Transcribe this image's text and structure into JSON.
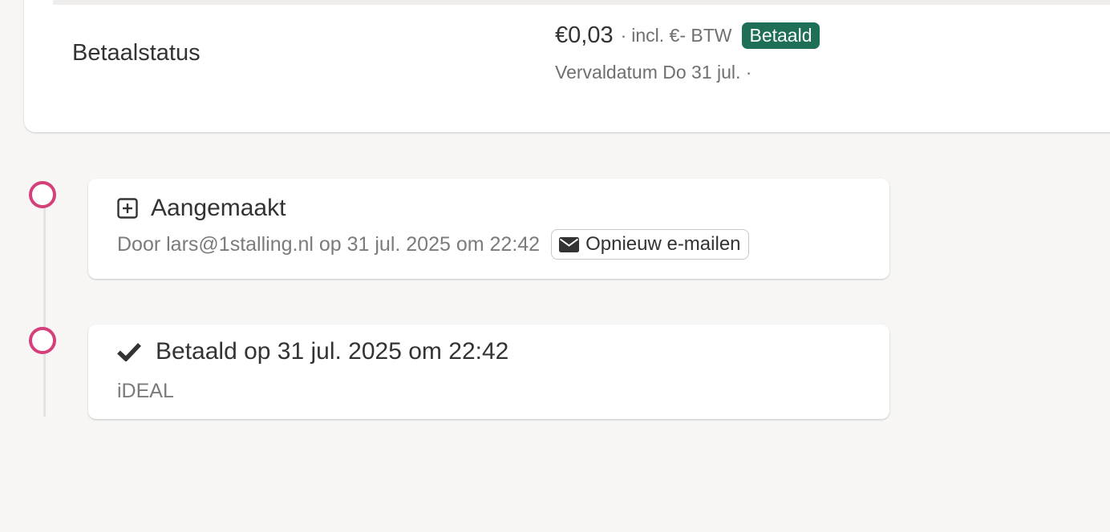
{
  "payment": {
    "label": "Betaalstatus",
    "amount": "€0,03",
    "separator": "·",
    "vat": "incl. €- BTW",
    "status_badge": "Betaald",
    "due": "Vervaldatum Do 31 jul. ·"
  },
  "timeline": {
    "events": [
      {
        "icon": "plus-square-icon",
        "title": "Aangemaakt",
        "meta": "Door lars@1stalling.nl op 31 jul. 2025 om 22:42",
        "action": {
          "icon": "envelope-icon",
          "label": "Opnieuw e-mailen"
        }
      },
      {
        "icon": "checkmark-icon",
        "title": "Betaald op 31 jul. 2025 om 22:42",
        "meta": "iDEAL"
      }
    ]
  },
  "colors": {
    "page_background": "#f7f6f5",
    "card_background": "#ffffff",
    "badge_green": "#1e6e58",
    "timeline_dot": "#d53f7a",
    "muted_text": "#6f6f6f"
  }
}
